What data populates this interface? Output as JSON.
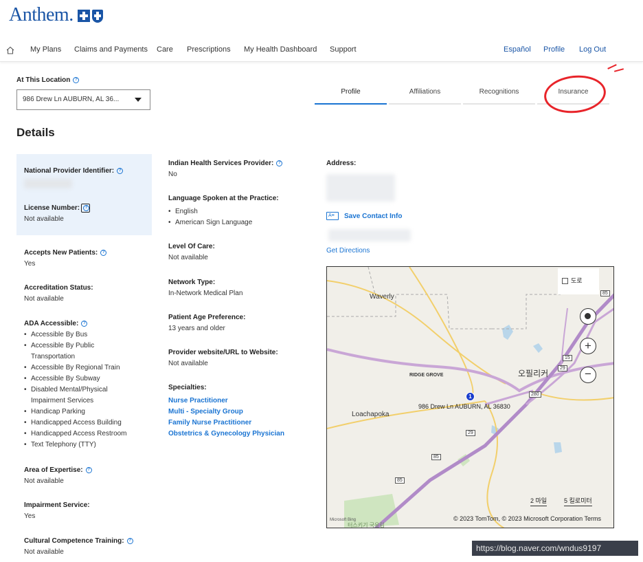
{
  "brand": {
    "name": "Anthem."
  },
  "nav": {
    "items": [
      "My Plans",
      "Claims and Payments",
      "Care",
      "Prescriptions",
      "My Health Dashboard",
      "Support"
    ],
    "right": [
      "Español",
      "Profile",
      "Log Out"
    ]
  },
  "location": {
    "label": "At This Location",
    "value": "986 Drew Ln AUBURN, AL 36..."
  },
  "tabs": [
    "Profile",
    "Affiliations",
    "Recognitions",
    "Insurance"
  ],
  "active_tab": "Profile",
  "details_title": "Details",
  "col1": {
    "npi_label": "National Provider Identifier:",
    "license_label": "License Number:",
    "license_value": "Not available",
    "accepts_label": "Accepts New Patients:",
    "accepts_value": "Yes",
    "accred_label": "Accreditation Status:",
    "accred_value": "Not available",
    "ada_label": "ADA Accessible:",
    "ada_items": [
      "Accessible By Bus",
      "Accessible By Public Transportation",
      "Accessible By Regional Train",
      "Accessible By Subway",
      "Disabled Mental/Physical Impairment Services",
      "Handicap Parking",
      "Handicapped Access Building",
      "Handicapped Access Restroom",
      "Text Telephony (TTY)"
    ],
    "expertise_label": "Area of Expertise:",
    "expertise_value": "Not available",
    "impairment_label": "Impairment Service:",
    "impairment_value": "Yes",
    "cultural_label": "Cultural Competence Training:",
    "cultural_value": "Not available"
  },
  "col2": {
    "ihs_label": "Indian Health Services Provider:",
    "ihs_value": "No",
    "lang_label": "Language Spoken at the Practice:",
    "lang_items": [
      "English",
      "American Sign Language"
    ],
    "care_label": "Level Of Care:",
    "care_value": "Not available",
    "network_label": "Network Type:",
    "network_value": "In-Network Medical Plan",
    "age_label": "Patient Age Preference:",
    "age_value": "13 years and older",
    "website_label": "Provider website/URL to Website:",
    "website_value": "Not available",
    "spec_label": "Specialties:",
    "spec_items": [
      "Nurse Practitioner",
      "Multi - Specialty Group",
      "Family Nurse Practitioner",
      "Obstetrics & Gynecology Physician"
    ]
  },
  "col3": {
    "address_label": "Address:",
    "save_contact": "Save Contact Info",
    "contact_icon": "contact-card-icon",
    "directions": "Get Directions"
  },
  "map": {
    "road_toggle": "도로",
    "places": [
      "Waverly",
      "RIDGE GROVE",
      "오필리커",
      "Loachapoka",
      "터스키기 국유림"
    ],
    "pin_number": "1",
    "pin_label": "986 Drew Ln AUBURN, AL 36830",
    "route_numbers": [
      "85",
      "15",
      "29",
      "280",
      "29",
      "85",
      "85"
    ],
    "scale_mi": "2 마일",
    "scale_km": "5 킬로미터",
    "bing": "Microsoft Bing",
    "copyright": "© 2023 TomTom, © 2023 Microsoft Corporation  Terms"
  },
  "watermark": "https://blog.naver.com/wndus9197",
  "colors": {
    "brand": "#1a55a6",
    "link": "#1a74d2",
    "annotation": "#e8242a"
  }
}
